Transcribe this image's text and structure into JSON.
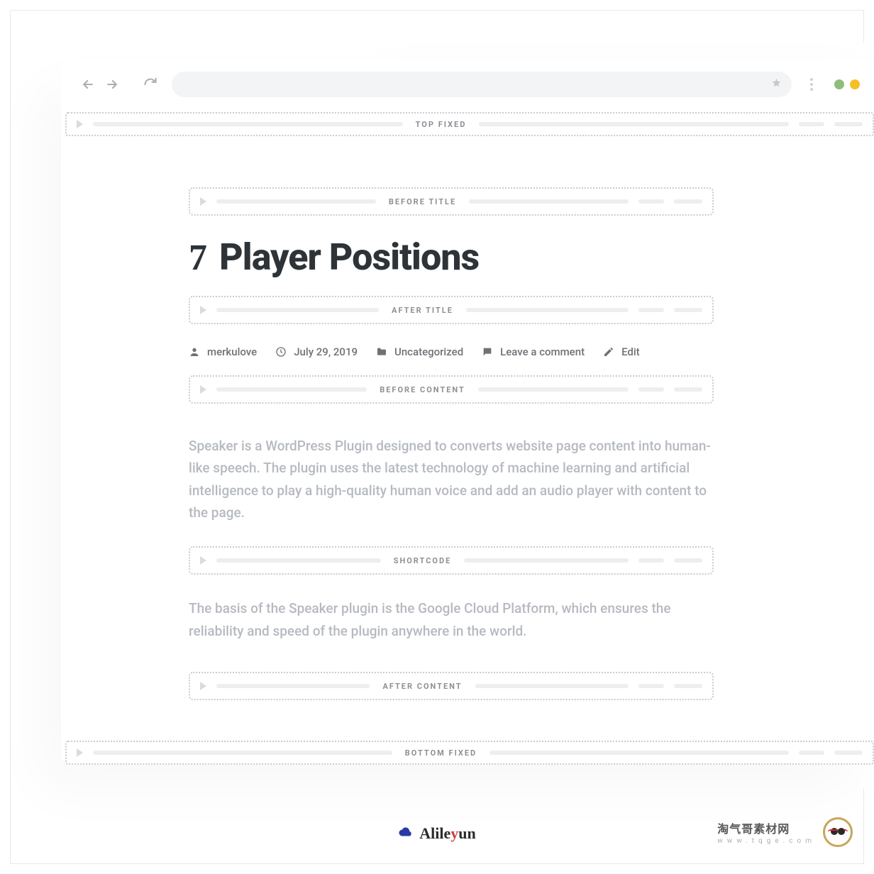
{
  "slots": {
    "top_fixed": "TOP FIXED",
    "before_title": "BEFORE TITLE",
    "after_title": "AFTER TITLE",
    "before_content": "BEFORE CONTENT",
    "shortcode": "SHORTCODE",
    "after_content": "AFTER CONTENT",
    "bottom_fixed": "BOTTOM FIXED"
  },
  "title": {
    "number": "7",
    "text": "Player Positions"
  },
  "meta": {
    "author": "merkulove",
    "date": "July 29, 2019",
    "category": "Uncategorized",
    "comments": "Leave a comment",
    "edit": "Edit"
  },
  "content": {
    "p1": "Speaker is a WordPress Plugin designed to converts website page content into human-like speech. The plugin uses the latest technology of machine learning and artificial intelligence to play a high-quality human voice and add an audio player with content to the page.",
    "p2": "The basis of the Speaker plugin is the Google Cloud Platform, which ensures the reliability and speed of the plugin anywhere in the world."
  },
  "watermarks": {
    "alileyun_a": "Alile",
    "alileyun_b": "un",
    "tqge_title": "淘气哥素材网",
    "tqge_url": "www.tqge.com"
  }
}
